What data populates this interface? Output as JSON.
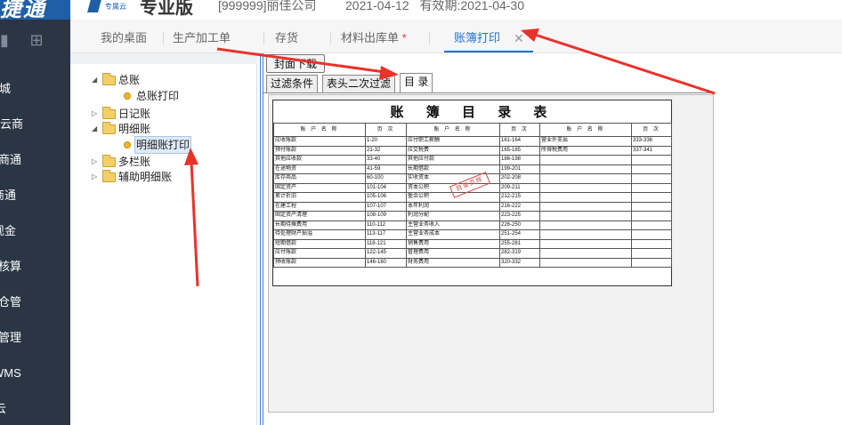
{
  "header": {
    "logo_text": "捷通",
    "brand_small": "专属云",
    "brand_big": "专业版",
    "company": "[999999]丽佳公司",
    "dates": "2021-04-12 有效期:2021-04-30"
  },
  "leftnav": {
    "items": [
      "商城",
      "云商",
      "商通",
      "商通",
      "现金",
      "核算",
      "仓管",
      "管理",
      "WMS",
      "云"
    ]
  },
  "tabs": [
    {
      "label": "我的桌面"
    },
    {
      "label": "生产加工单"
    },
    {
      "label": "存货"
    },
    {
      "label": "材料出库单",
      "star": "*"
    },
    {
      "label": "账簿打印",
      "close": "✕"
    }
  ],
  "tree": {
    "nodes": [
      {
        "label": "总账",
        "toggle": "◢"
      },
      {
        "label": "总账打印"
      },
      {
        "label": "日记账",
        "toggle": "▷"
      },
      {
        "label": "明细账",
        "toggle": "◢"
      },
      {
        "label": "明细账打印"
      },
      {
        "label": "多栏账",
        "toggle": "▷"
      },
      {
        "label": "辅助明细账",
        "toggle": "▷"
      }
    ]
  },
  "content": {
    "print_button": "封面下载",
    "subtabs": [
      "过滤条件",
      "表头二次过滤",
      "目 录"
    ],
    "sheet_title": "账 簿 目 录 表",
    "stamp": "目录页样",
    "columns": [
      "账 户 名 称",
      "页 次",
      "账 户 名 称",
      "页 次",
      "账 户 名 称",
      "页 次"
    ],
    "rows": [
      [
        "应收账款",
        "1-20",
        "应付职工薪酬",
        "161-164",
        "营业外支出",
        "333-336"
      ],
      [
        "预付账款",
        "21-32",
        "应交税费",
        "165-185",
        "所得税费用",
        "337-341"
      ],
      [
        "其他应收款",
        "33-40",
        "其他应付款",
        "186-198",
        "",
        ""
      ],
      [
        "在途物资",
        "41-59",
        "长期借款",
        "199-201",
        "",
        ""
      ],
      [
        "库存商品",
        "60-100",
        "实收资本",
        "202-208",
        "",
        ""
      ],
      [
        "固定资产",
        "101-104",
        "资本公积",
        "209-211",
        "",
        ""
      ],
      [
        "累计折旧",
        "105-106",
        "盈余公积",
        "212-215",
        "",
        ""
      ],
      [
        "在建工程",
        "107-107",
        "本年利润",
        "216-222",
        "",
        ""
      ],
      [
        "固定资产清理",
        "108-109",
        "利润分配",
        "223-225",
        "",
        ""
      ],
      [
        "长期待摊费用",
        "110-112",
        "主营业务收入",
        "226-250",
        "",
        ""
      ],
      [
        "待处理财产损溢",
        "113-117",
        "主营业务成本",
        "251-254",
        "",
        ""
      ],
      [
        "短期借款",
        "118-121",
        "销售费用",
        "255-281",
        "",
        ""
      ],
      [
        "应付账款",
        "122-145",
        "管理费用",
        "282-319",
        "",
        ""
      ],
      [
        "预收账款",
        "146-160",
        "财务费用",
        "320-332",
        "",
        ""
      ]
    ]
  },
  "colors": {
    "nav_bg": "#2a3644",
    "accent": "#1f72d8",
    "annotation": "#e8322a"
  }
}
